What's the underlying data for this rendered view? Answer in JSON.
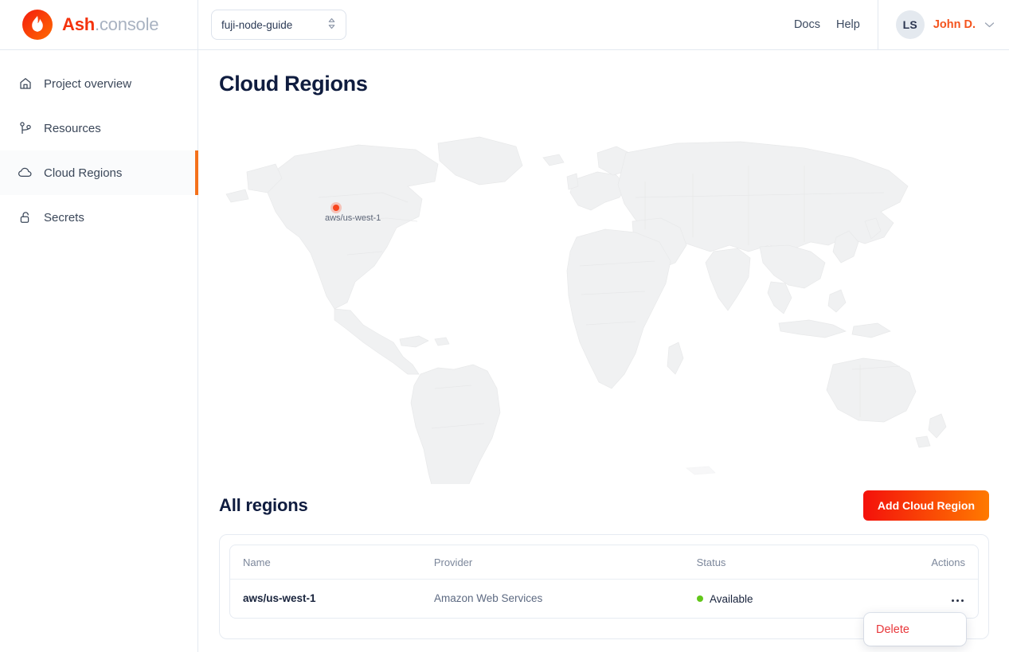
{
  "brand": {
    "name_bold": "Ash",
    "name_light": ".console",
    "logo_icon": "flame-icon"
  },
  "header": {
    "project_selector": {
      "value": "fuji-node-guide",
      "icon": "chevron-up-down-icon"
    },
    "links": [
      {
        "label": "Docs",
        "name": "docs-link"
      },
      {
        "label": "Help",
        "name": "help-link"
      }
    ],
    "user": {
      "initials": "LS",
      "name": "John D.",
      "icon": "chevron-down-icon",
      "name_color": "#f4541d"
    }
  },
  "sidebar": {
    "items": [
      {
        "label": "Project overview",
        "icon": "home-icon",
        "active": false
      },
      {
        "label": "Resources",
        "icon": "branch-icon",
        "active": false
      },
      {
        "label": "Cloud Regions",
        "icon": "cloud-icon",
        "active": true
      },
      {
        "label": "Secrets",
        "icon": "unlock-icon",
        "active": false
      }
    ],
    "active_indicator_color": "#f4711b"
  },
  "main": {
    "page_title": "Cloud Regions",
    "map": {
      "marker_label": "aws/us-west-1",
      "marker_color": "#f7441c",
      "land_color": "#f0f1f2"
    },
    "regions_section": {
      "title": "All regions",
      "add_button": "Add Cloud Region",
      "add_button_gradient": "#f4110b -> #ff7a00"
    },
    "table": {
      "columns": [
        "Name",
        "Provider",
        "Status",
        "Actions"
      ],
      "rows": [
        {
          "name": "aws/us-west-1",
          "provider": "Amazon Web Services",
          "status": "Available",
          "status_color": "#62c71a",
          "actions_icon": "kebab-icon"
        }
      ]
    },
    "context_menu": {
      "items": [
        {
          "label": "Delete",
          "color": "#e8383b"
        }
      ]
    }
  }
}
